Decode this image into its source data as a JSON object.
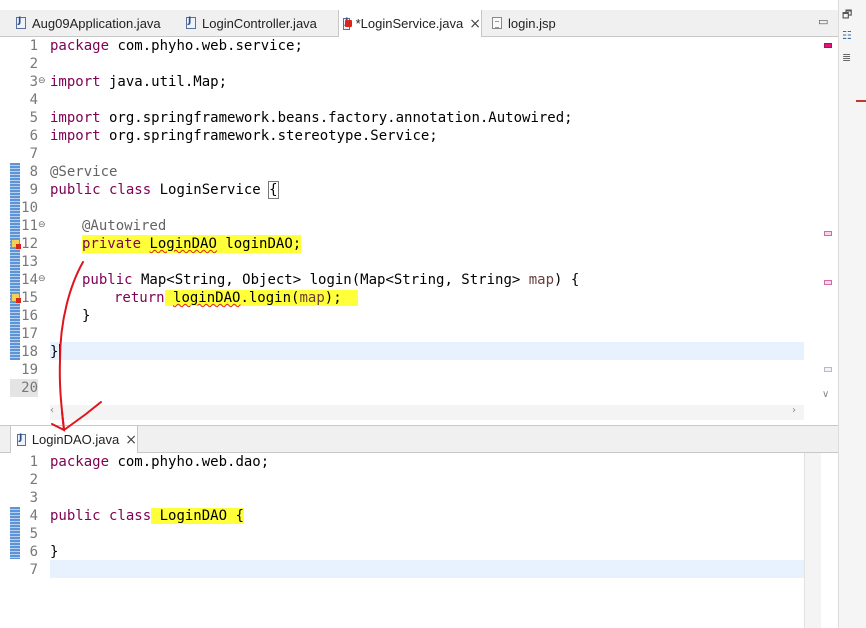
{
  "top_tabs": [
    {
      "label": "Aug09Application.java",
      "type": "java"
    },
    {
      "label": "LoginController.java",
      "type": "java"
    },
    {
      "label": "*LoginService.java",
      "type": "java",
      "active": true,
      "error": true
    },
    {
      "label": "login.jsp",
      "type": "jsp"
    }
  ],
  "bottom_tab": {
    "label": "LoginDAO.java"
  },
  "service_code": {
    "lines": [
      "1",
      "2",
      "3",
      "4",
      "5",
      "6",
      "7",
      "8",
      "9",
      "10",
      "11",
      "12",
      "13",
      "14",
      "15",
      "16",
      "17",
      "18",
      "19",
      "20"
    ],
    "l1_kw": "package",
    "l1_rest": " com.phyho.web.service;",
    "l3_kw": "import",
    "l3_rest": " java.util.Map;",
    "l5_kw": "import",
    "l5_rest": " org.springframework.beans.factory.annotation.Autowired;",
    "l6_kw": "import",
    "l6_rest": " org.springframework.stereotype.Service;",
    "l8_ann": "@Service",
    "l9_kw": "public class",
    "l9_rest": " LoginService ",
    "l9_brace": "{",
    "l11_ann": "@Autowired",
    "l12_kw": "private",
    "l12_type": "LoginDAO",
    "l12_rest": " loginDAO;",
    "l14_kw": "public",
    "l14_rest_a": " Map<String, Object> login(Map<String, String> ",
    "l14_param": "map",
    "l14_rest_b": ") {",
    "l15_kw": "return",
    "l15_ref": "loginDAO",
    "l15_rest_a": ".login(",
    "l15_param": "map",
    "l15_rest_b": ");",
    "l16": "}",
    "l18": "}"
  },
  "dao_code": {
    "lines": [
      "1",
      "2",
      "3",
      "4",
      "5",
      "6",
      "7"
    ],
    "l1_kw": "package",
    "l1_rest": " com.phyho.web.dao;",
    "l4_kw": "public class",
    "l4_rest": " LoginDAO {",
    "l6": "}"
  },
  "colors": {
    "keyword": "#7f0055",
    "highlight": "#ffff3a",
    "current_line": "#e8f2fe",
    "annotation_arrow": "#e0141c"
  },
  "icons": [
    "java-file-icon",
    "jsp-file-icon",
    "close-icon",
    "restore-icon",
    "outline-icon",
    "warning-icon"
  ]
}
